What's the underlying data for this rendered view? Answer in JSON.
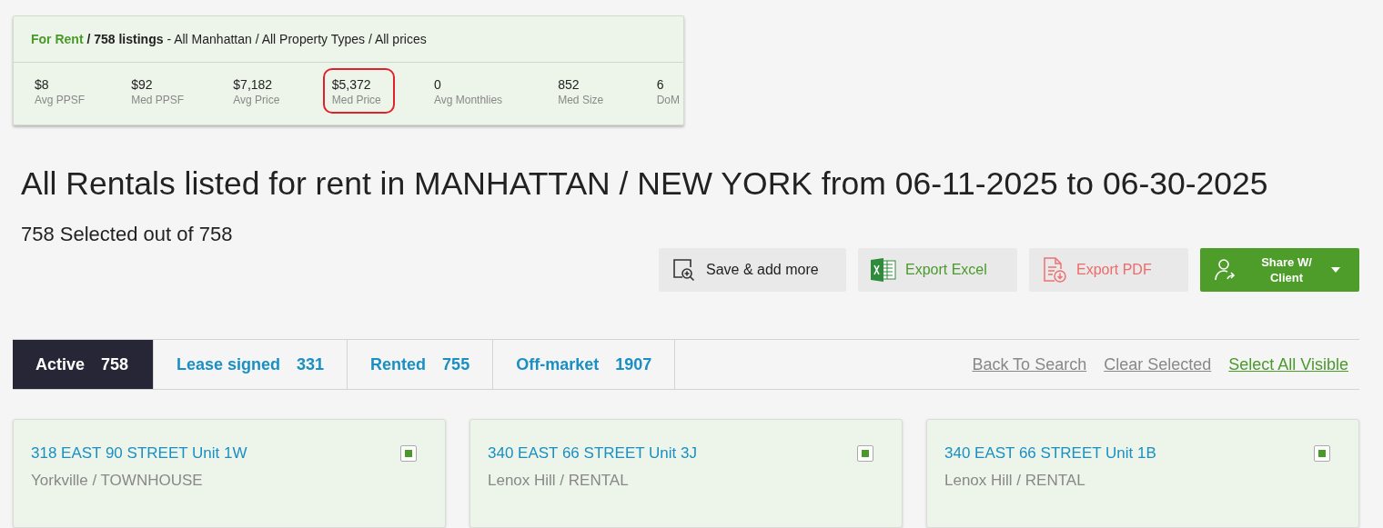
{
  "summary": {
    "category": "For Rent",
    "count": "/ 758 listings",
    "filters": "- All Manhattan / All Property Types / All prices",
    "stats": [
      {
        "value": "$8",
        "label": "Avg PPSF",
        "highlighted": false
      },
      {
        "value": "$92",
        "label": "Med PPSF",
        "highlighted": false
      },
      {
        "value": "$7,182",
        "label": "Avg Price",
        "highlighted": false
      },
      {
        "value": "$5,372",
        "label": "Med Price",
        "highlighted": true
      },
      {
        "value": "0",
        "label": "Avg Monthlies",
        "highlighted": false
      },
      {
        "value": "852",
        "label": "Med Size",
        "highlighted": false
      },
      {
        "value": "6",
        "label": "DoM",
        "highlighted": false
      }
    ]
  },
  "title": "All Rentals listed for rent in MANHATTAN / NEW YORK from 06-11-2025 to 06-30-2025",
  "selection": "758 Selected out of 758",
  "actions": [
    {
      "kind": "save",
      "label": "Save & add more"
    },
    {
      "kind": "excel",
      "label": "Export Excel"
    },
    {
      "kind": "pdf",
      "label": "Export PDF"
    },
    {
      "kind": "share",
      "label": "Share W/ Client"
    }
  ],
  "tabs": [
    {
      "label": "Active",
      "count": "758",
      "selected": true
    },
    {
      "label": "Lease signed",
      "count": "331",
      "selected": false
    },
    {
      "label": "Rented",
      "count": "755",
      "selected": false
    },
    {
      "label": "Off-market",
      "count": "1907",
      "selected": false
    }
  ],
  "links": [
    {
      "label": "Back To Search",
      "kind": "muted"
    },
    {
      "label": "Clear Selected",
      "kind": "muted"
    },
    {
      "label": "Select All Visible",
      "kind": "accent"
    }
  ],
  "listings": [
    {
      "address": "318 EAST 90 STREET Unit 1W",
      "area": "Yorkville / TOWNHOUSE",
      "checked": true
    },
    {
      "address": "340 EAST 66 STREET Unit 3J",
      "area": "Lenox Hill / RENTAL",
      "checked": true
    },
    {
      "address": "340 EAST 66 STREET Unit 1B",
      "area": "Lenox Hill / RENTAL",
      "checked": true
    }
  ]
}
